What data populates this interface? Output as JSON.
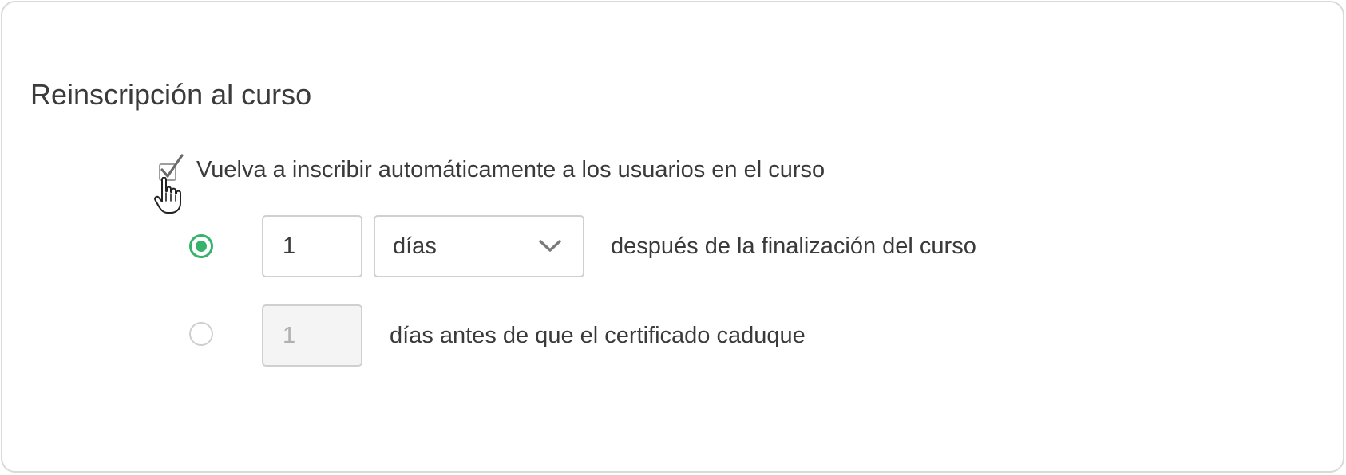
{
  "section": {
    "title": "Reinscripción al curso"
  },
  "auto_reenroll": {
    "checked": true,
    "label": "Vuelva a inscribir automáticamente a los usuarios en el curso"
  },
  "option_after_completion": {
    "selected": true,
    "amount": "1",
    "unit": "días",
    "label": "después de la finalización del curso"
  },
  "option_before_expiry": {
    "selected": false,
    "amount": "1",
    "label": "días antes de que el certificado caduque"
  },
  "icons": {
    "checkbox": "check-icon",
    "cursor": "hand-pointer-icon",
    "dropdown": "chevron-down-icon"
  },
  "colors": {
    "accent_green": "#36b36b",
    "border": "#d0d0d0",
    "disabled_bg": "#f4f4f4",
    "text": "#3a3a3a"
  }
}
